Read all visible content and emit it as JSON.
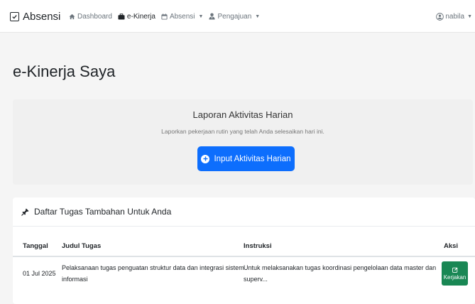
{
  "navbar": {
    "brand": "Absensi",
    "items": [
      {
        "label": "Dashboard",
        "icon": "home-icon",
        "active": false,
        "dropdown": false
      },
      {
        "label": "e-Kinerja",
        "icon": "briefcase-icon",
        "active": true,
        "dropdown": false
      },
      {
        "label": "Absensi",
        "icon": "calendar-icon",
        "active": false,
        "dropdown": true
      },
      {
        "label": "Pengajuan",
        "icon": "user-tie-icon",
        "active": false,
        "dropdown": true
      }
    ],
    "user": "nabila"
  },
  "page": {
    "title": "e-Kinerja Saya"
  },
  "report": {
    "title": "Laporan Aktivitas Harian",
    "subtitle": "Laporkan pekerjaan rutin yang telah Anda selesaikan hari ini.",
    "button": "Input Aktivitas Harian"
  },
  "tasks": {
    "header": "Daftar Tugas Tambahan Untuk Anda",
    "columns": [
      "Tanggal",
      "Judul Tugas",
      "Instruksi",
      "Aksi"
    ],
    "rows": [
      {
        "date": "01 Jul 2025",
        "title_line1": "Pelaksanaan tugas penguatan struktur data dan integrasi sistem",
        "title_line2": "informasi",
        "instr_line1": "Untuk melaksanakan tugas koordinasi pengelolaan data master dan",
        "instr_line2": "superv...",
        "action": "Kerjakan"
      }
    ]
  },
  "colors": {
    "primary": "#0d6efd",
    "success": "#198754",
    "background": "#f5f5f5"
  }
}
